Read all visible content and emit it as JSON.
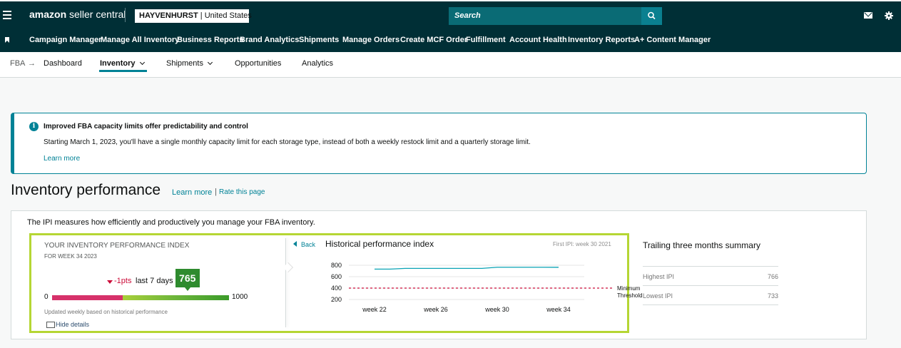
{
  "header": {
    "logo_main": "amazon",
    "logo_sub": " seller central",
    "store_name": "HAYVENHURST",
    "store_region": " | United States",
    "search_placeholder": "Search",
    "colors": {
      "bar": "#002f36",
      "search": "#0a6b75",
      "accent": "#008296"
    }
  },
  "nav": {
    "items": [
      "Campaign Manager",
      "Manage All Inventory",
      "Business Reports",
      "Brand Analytics",
      "Shipments",
      "Manage Orders",
      "Create MCF Order",
      "Fulfillment",
      "Account Health",
      "Inventory Reports",
      "A+ Content Manager"
    ]
  },
  "subnav": {
    "crumb": "FBA",
    "crumb_arrow": "→",
    "tabs": [
      "Dashboard",
      "Inventory",
      "Shipments",
      "Opportunities",
      "Analytics"
    ],
    "active_tab": "Inventory"
  },
  "alert": {
    "title": "Improved FBA capacity limits offer predictability and control",
    "body": "Starting March 1, 2023, you'll have a single monthly capacity limit for each storage type, instead of both a weekly restock limit and a quarterly storage limit.",
    "link": "Learn more"
  },
  "section": {
    "title": "Inventory performance",
    "learn_more": "Learn more",
    "separator": "|",
    "rate": "Rate this page"
  },
  "card": {
    "intro": "The IPI measures how efficiently and productively you manage your FBA inventory."
  },
  "ipi": {
    "label": "YOUR INVENTORY PERFORMANCE INDEX",
    "week": "FOR WEEK 34 2023",
    "change": "-1pts",
    "period": "last 7 days",
    "score": "765",
    "score_value": 765,
    "min": "0",
    "max": "1000",
    "note": "Updated weekly based on historical performance",
    "hide_details": "Hide details"
  },
  "history": {
    "back": "Back",
    "title": "Historical performance index",
    "first_ipi": "First IPI: week 30 2021"
  },
  "chart_data": {
    "type": "line",
    "x": [
      "week 22",
      "week 23",
      "week 24",
      "week 25",
      "week 26",
      "week 27",
      "week 28",
      "week 29",
      "week 30",
      "week 31",
      "week 32",
      "week 33",
      "week 34"
    ],
    "x_tick_labels": [
      "week 22",
      "week 26",
      "week 30",
      "week 34"
    ],
    "y_tick_labels": [
      "800",
      "600",
      "400",
      "200"
    ],
    "ylim": [
      200,
      800
    ],
    "series": [
      {
        "values": [
          733,
          733,
          745,
          745,
          745,
          745,
          745,
          745,
          766,
          766,
          766,
          766,
          765
        ],
        "color": "#0aa3b5"
      }
    ],
    "threshold": {
      "value": 400,
      "label_line1": "Minimum",
      "label_line2": "Threshold",
      "color": "#cc0c39"
    },
    "grid": true,
    "legend": "none"
  },
  "summary": {
    "title": "Trailing three months summary",
    "rows": [
      {
        "label": "Highest IPI",
        "value": "766"
      },
      {
        "label": "Lowest IPI",
        "value": "733"
      }
    ]
  }
}
